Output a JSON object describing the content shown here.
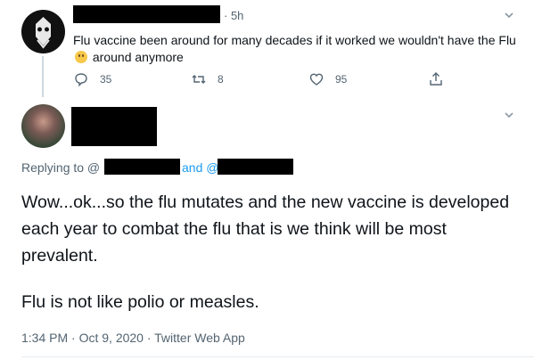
{
  "tweet1": {
    "time": "· 5h",
    "text_part1": "Flu vaccine been around for many decades if it worked we wouldn't have the Flu",
    "text_part2": "around anymore",
    "emoji_icon": "thinking-face-emoji",
    "reply_count": "35",
    "retweet_count": "8",
    "like_count": "95"
  },
  "tweet2": {
    "replying_to": "Replying to @",
    "and_label": "and @",
    "paragraph1": "Wow...ok...so the flu mutates and the new vaccine is developed each year to combat the flu that is we think will be most prevalent.",
    "paragraph2": "Flu is not like polio or measles.",
    "timestamp": "1:34 PM · Oct 9, 2020 · Twitter Web App"
  },
  "colors": {
    "text": "#0f1419",
    "muted": "#536471",
    "link": "#1d9bf0",
    "divider": "#e6ecf0",
    "redaction": "#000000"
  }
}
